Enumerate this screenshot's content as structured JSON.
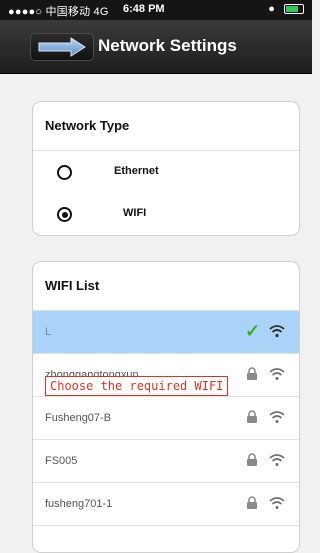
{
  "status_bar": {
    "carrier": "●●●●○ 中国移动 4G",
    "time": "6:48 PM"
  },
  "header": {
    "title": "Network Settings",
    "back_icon": "right-arrow-icon"
  },
  "network_type": {
    "heading": "Network Type",
    "options": [
      {
        "label": "Ethernet",
        "selected": false
      },
      {
        "label": "WIFI",
        "selected": true
      }
    ]
  },
  "wifi_list": {
    "heading": "WIFI List",
    "items": [
      {
        "name": "L",
        "connected": true,
        "locked": false
      },
      {
        "name": "zhonggangtongxun",
        "connected": false,
        "locked": true
      },
      {
        "name": "Fusheng07-B",
        "connected": false,
        "locked": true
      },
      {
        "name": "FS005",
        "connected": false,
        "locked": true
      },
      {
        "name": "fusheng701-1",
        "connected": false,
        "locked": true
      }
    ]
  },
  "annotation": {
    "text": "Choose the required WIFI"
  },
  "colors": {
    "selected_row": "#a9d4f7",
    "check": "#3aaa35",
    "annotation": "#d9342b"
  }
}
